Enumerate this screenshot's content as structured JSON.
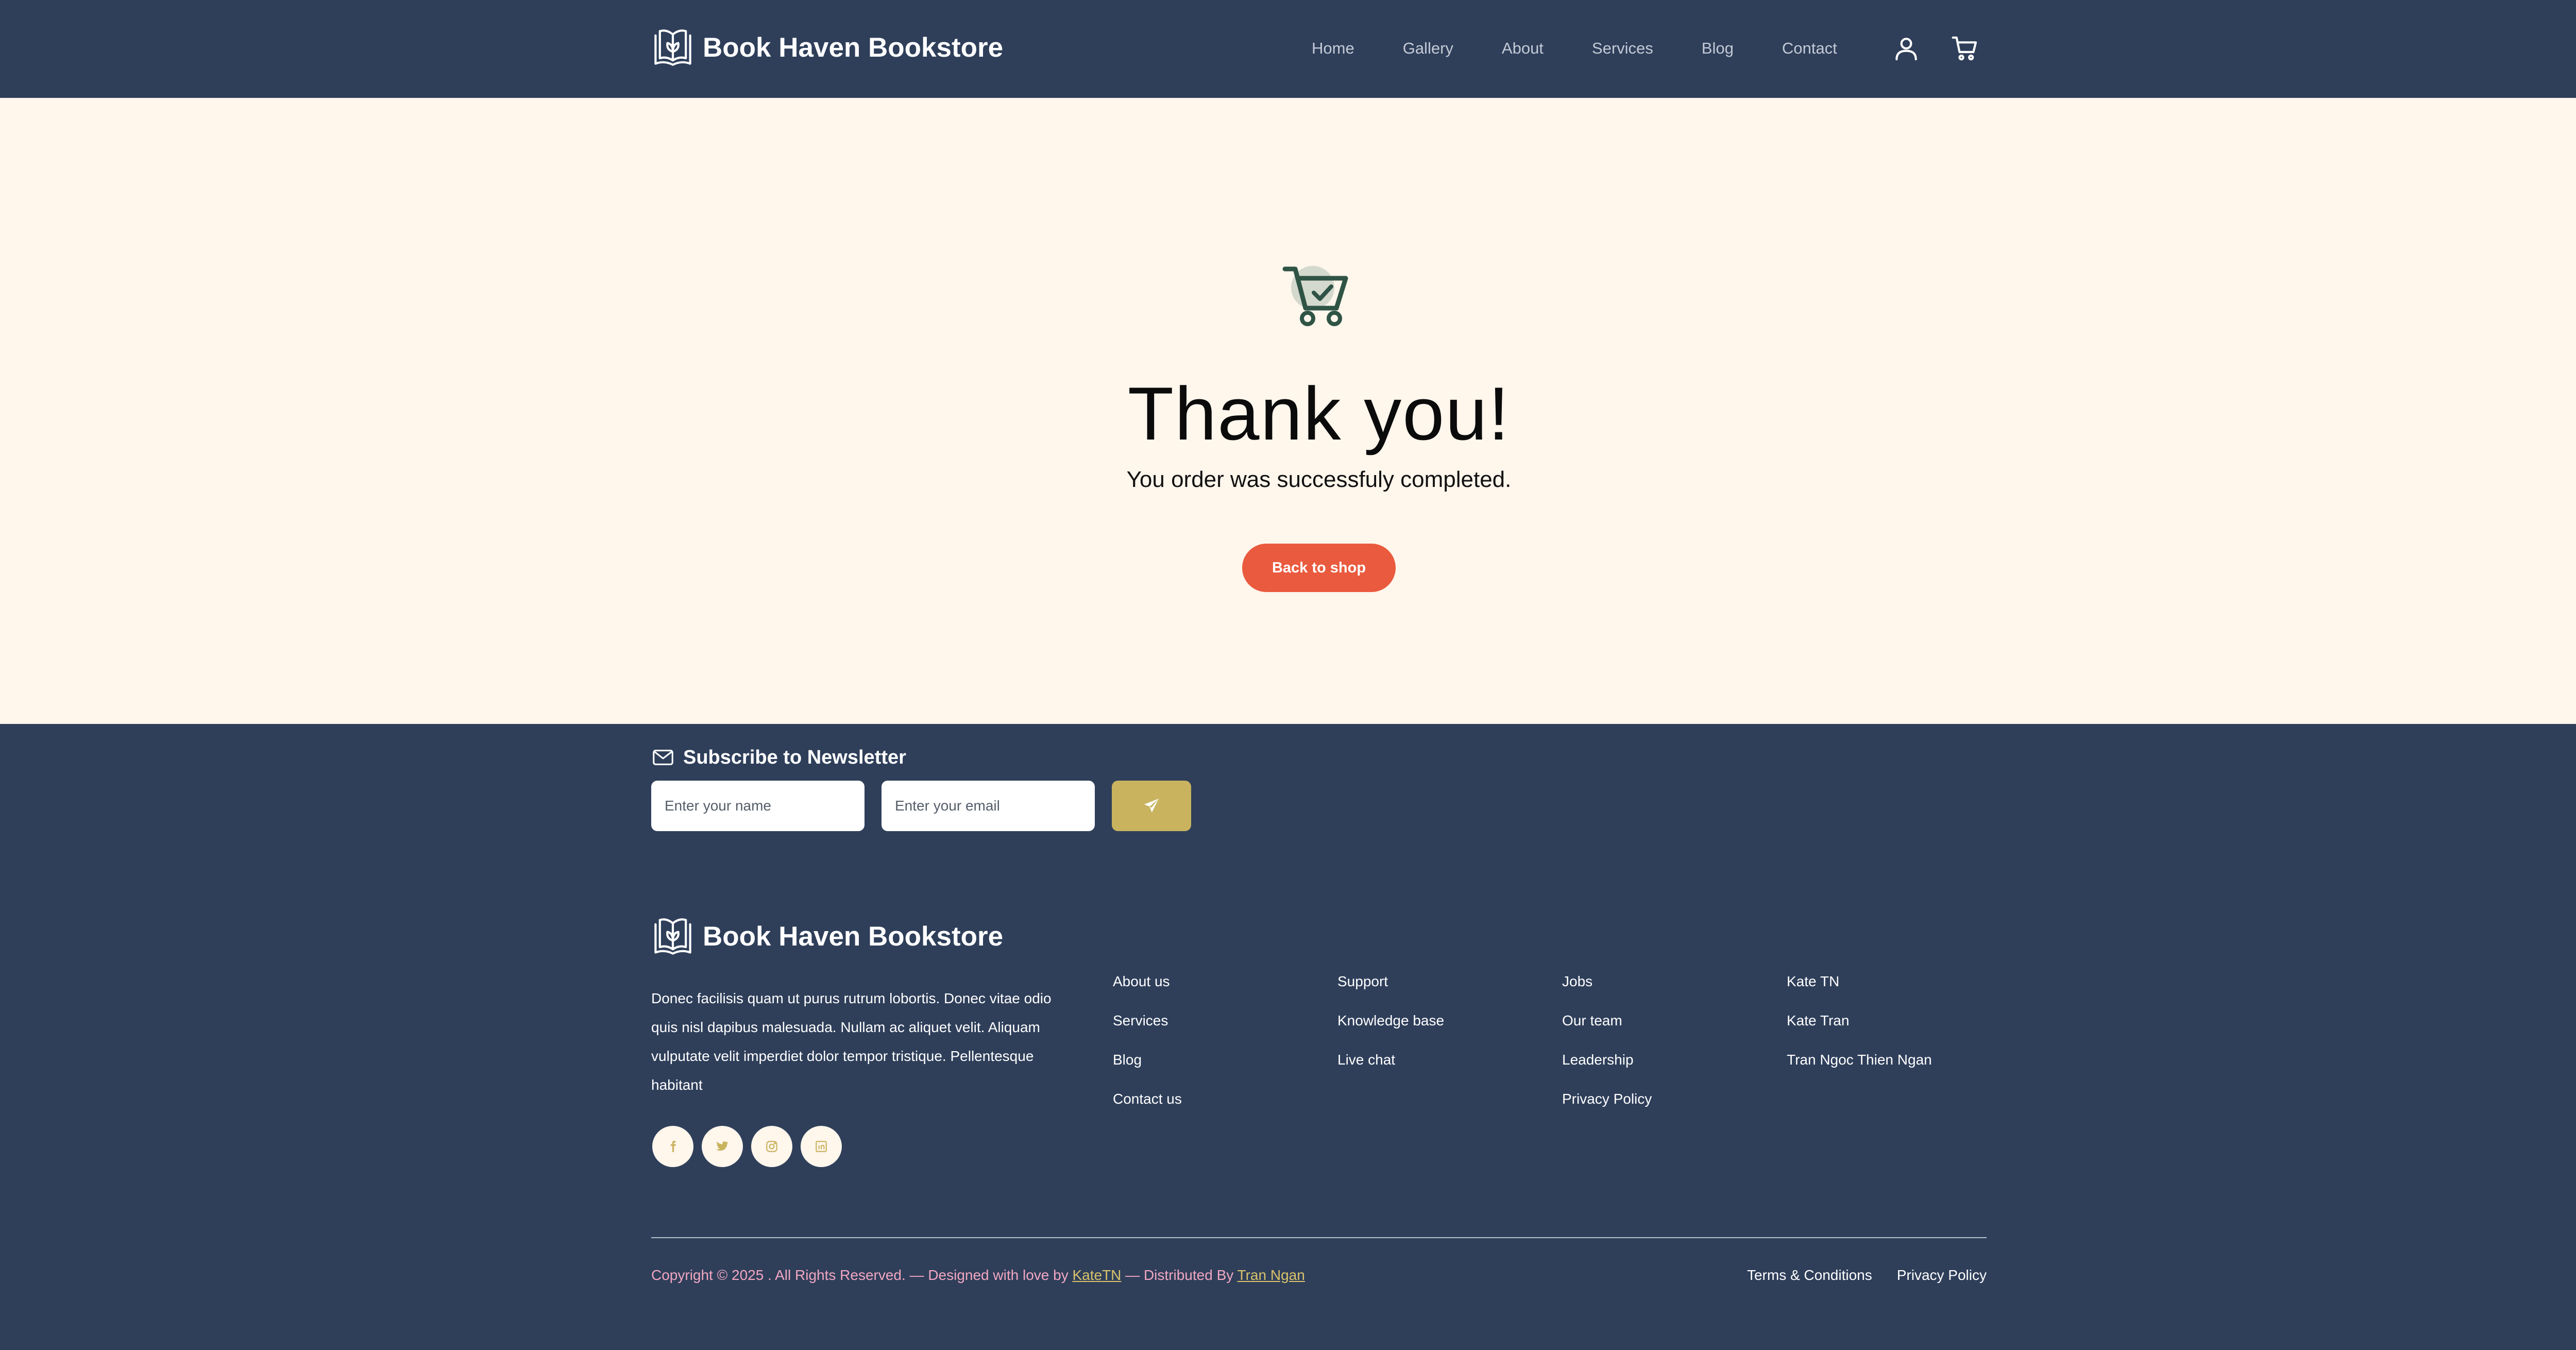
{
  "header": {
    "brand": "Book Haven Bookstore",
    "nav": [
      {
        "label": "Home"
      },
      {
        "label": "Gallery"
      },
      {
        "label": "About"
      },
      {
        "label": "Services"
      },
      {
        "label": "Blog"
      },
      {
        "label": "Contact"
      }
    ],
    "icons": [
      "user-icon",
      "cart-icon"
    ]
  },
  "main": {
    "illustration": "cart-check-icon",
    "title": "Thank you!",
    "subtitle": "You order was successfuly completed.",
    "button_label": "Back to shop"
  },
  "newsletter": {
    "icon": "envelope-icon",
    "title": "Subscribe to Newsletter",
    "name_placeholder": "Enter your name",
    "email_placeholder": "Enter your email",
    "send_icon": "paper-plane-icon"
  },
  "footer": {
    "brand": "Book Haven Bookstore",
    "description": "Donec facilisis quam ut purus rutrum lobortis. Donec vitae odio quis nisl dapibus malesuada. Nullam ac aliquet velit. Aliquam vulputate velit imperdiet dolor tempor tristique. Pellentesque habitant",
    "socials": [
      "facebook-icon",
      "twitter-icon",
      "instagram-icon",
      "linkedin-icon"
    ],
    "columns": [
      {
        "links": [
          "About us",
          "Services",
          "Blog",
          "Contact us"
        ]
      },
      {
        "links": [
          "Support",
          "Knowledge base",
          "Live chat"
        ]
      },
      {
        "links": [
          "Jobs",
          "Our team",
          "Leadership",
          "Privacy Policy"
        ]
      },
      {
        "links": [
          "Kate TN",
          "Kate Tran",
          "Tran Ngoc Thien Ngan"
        ]
      }
    ],
    "copyright": {
      "prefix": "Copyright © 2025 . All Rights Reserved. — Designed with love by ",
      "designer": "KateTN",
      "middle": " — Distributed By ",
      "distributor": "Tran Ngan"
    },
    "legal": [
      "Terms & Conditions",
      "Privacy Policy"
    ]
  },
  "colors": {
    "navy": "#2f3f5a",
    "cream": "#fff6ec",
    "accent_orange": "#ea5a3e",
    "accent_gold": "#c9b35f",
    "cart_green": "#2f5445",
    "copyright_pink": "#f2a7c2"
  }
}
